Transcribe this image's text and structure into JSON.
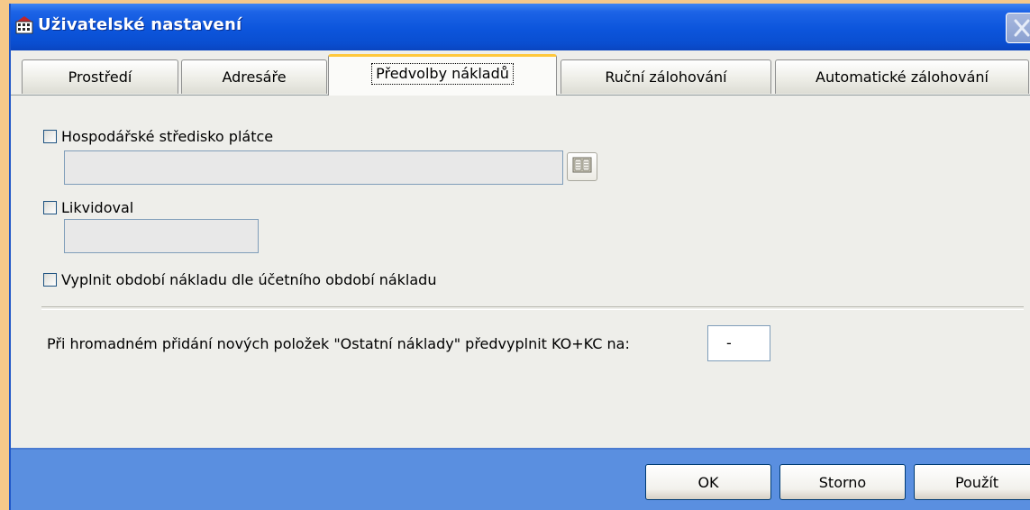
{
  "window": {
    "title": "Uživatelské nastavení"
  },
  "tabs": [
    {
      "label": "Prostředí",
      "active": false
    },
    {
      "label": "Adresáře",
      "active": false
    },
    {
      "label": "Předvolby nákladů",
      "active": true
    },
    {
      "label": "Ruční zálohování",
      "active": false
    },
    {
      "label": "Automatické zálohování",
      "active": false
    }
  ],
  "form": {
    "cost_center_label": "Hospodářské středisko plátce",
    "cost_center_checked": false,
    "cost_center_value": "",
    "liquidated_label": "Likvidoval",
    "liquidated_checked": false,
    "liquidated_value": "",
    "fill_period_label": "Vyplnit období nákladu dle účetního období nákladu",
    "fill_period_checked": false,
    "bulk_label": "Při hromadném přidání nových položek \"Ostatní náklady\" předvyplnit KO+KC na:",
    "bulk_value": "-"
  },
  "buttons": {
    "ok": "OK",
    "cancel": "Storno",
    "apply": "Použít"
  },
  "colors": {
    "titlebar": "#0c55dc",
    "window_frame": "#5a8fe0",
    "panel": "#eeeeea",
    "active_tab_accent": "#ffc83c"
  },
  "icons": {
    "app": "app-grid-icon",
    "close": "close-icon",
    "book": "book-icon"
  }
}
